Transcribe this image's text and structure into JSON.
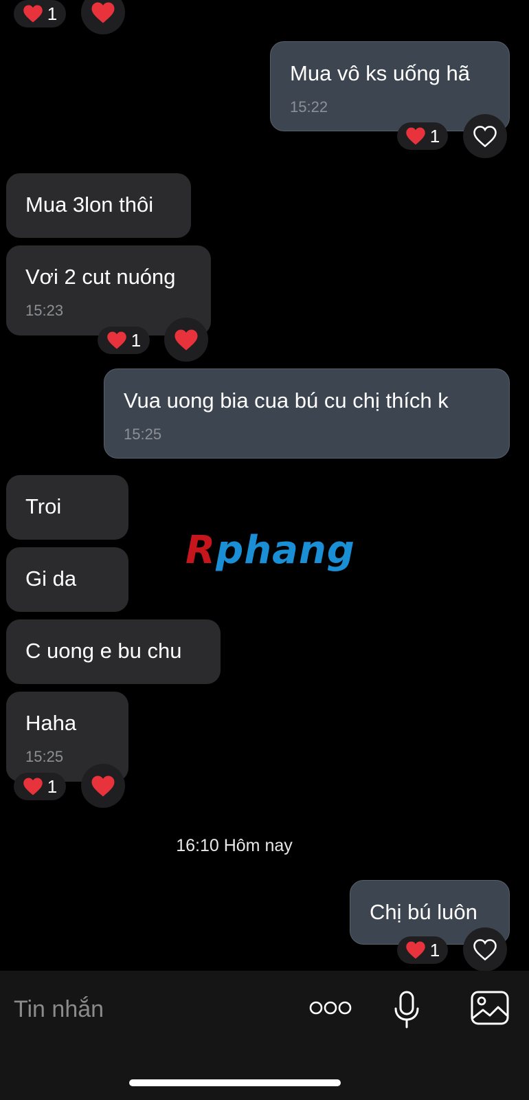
{
  "messages": [
    {
      "text": "Mua vô ks uống hã",
      "time": "15:22",
      "reactions": "1"
    },
    {
      "text": "Mua 3lon thôi"
    },
    {
      "text": "Vơi 2 cut nuóng",
      "time": "15:23",
      "reactions": "1"
    },
    {
      "text": "Vua uong bia cua bú cu chị thích k",
      "time": "15:25"
    },
    {
      "text": "Troi"
    },
    {
      "text": "Gi da"
    },
    {
      "text": "C uong e bu chu"
    },
    {
      "text": "Haha",
      "time": "15:25",
      "reactions": "1"
    },
    {
      "text": "Chị bú luôn",
      "reactions": "1"
    }
  ],
  "top_reactions": "1",
  "time_separator": "16:10 Hôm nay",
  "watermark": {
    "first": "R",
    "rest": "phang"
  },
  "composer": {
    "placeholder": "Tin nhắn"
  },
  "icons": {
    "heart_filled": "red-heart-icon",
    "heart_outline": "heart-outline-icon",
    "more": "more-dots-icon",
    "mic": "microphone-icon",
    "gallery": "image-gallery-icon"
  },
  "colors": {
    "background": "#000000",
    "incoming_bubble": "#2b2b2d",
    "outgoing_bubble": "#3c4550",
    "heart": "#e8323c"
  }
}
